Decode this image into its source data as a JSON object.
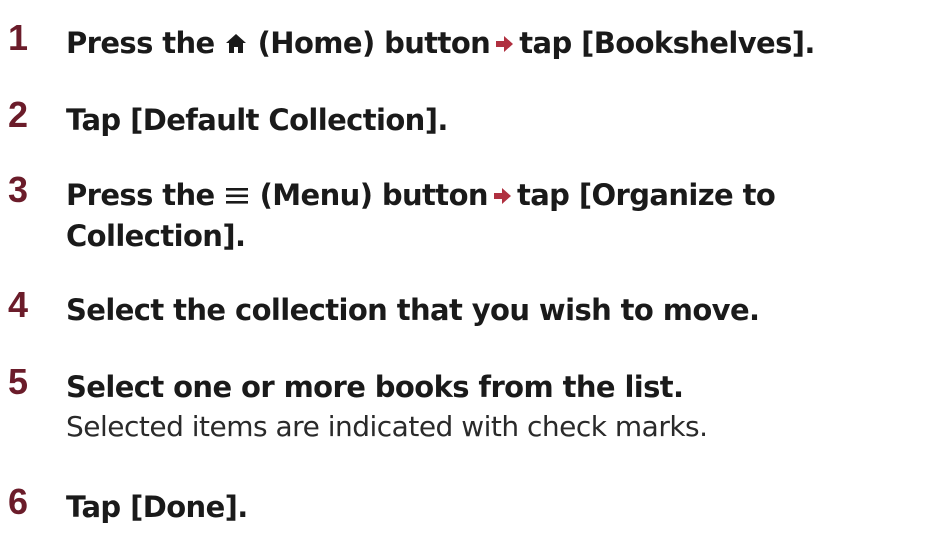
{
  "steps": [
    {
      "number": "1",
      "part_a": "Press the ",
      "icon_a": "home-icon",
      "part_b": " (Home) button",
      "arrow": "arrow-right-icon",
      "part_c": "tap [Bookshelves]."
    },
    {
      "number": "2",
      "text": "Tap [Default Collection]."
    },
    {
      "number": "3",
      "part_a": "Press the ",
      "icon_a": "menu-icon",
      "part_b": " (Menu) button",
      "arrow": "arrow-right-icon",
      "part_c": "tap [Organize to",
      "line2": "Collection]."
    },
    {
      "number": "4",
      "text": "Select the collection that you wish to move."
    },
    {
      "number": "5",
      "text": "Select one or more books from the list.",
      "note": "Selected items are indicated with check marks."
    },
    {
      "number": "6",
      "text": "Tap [Done]."
    }
  ],
  "colors": {
    "step_number": "#6b1c2a",
    "arrow": "#b03040",
    "text": "#1a1a1a"
  }
}
